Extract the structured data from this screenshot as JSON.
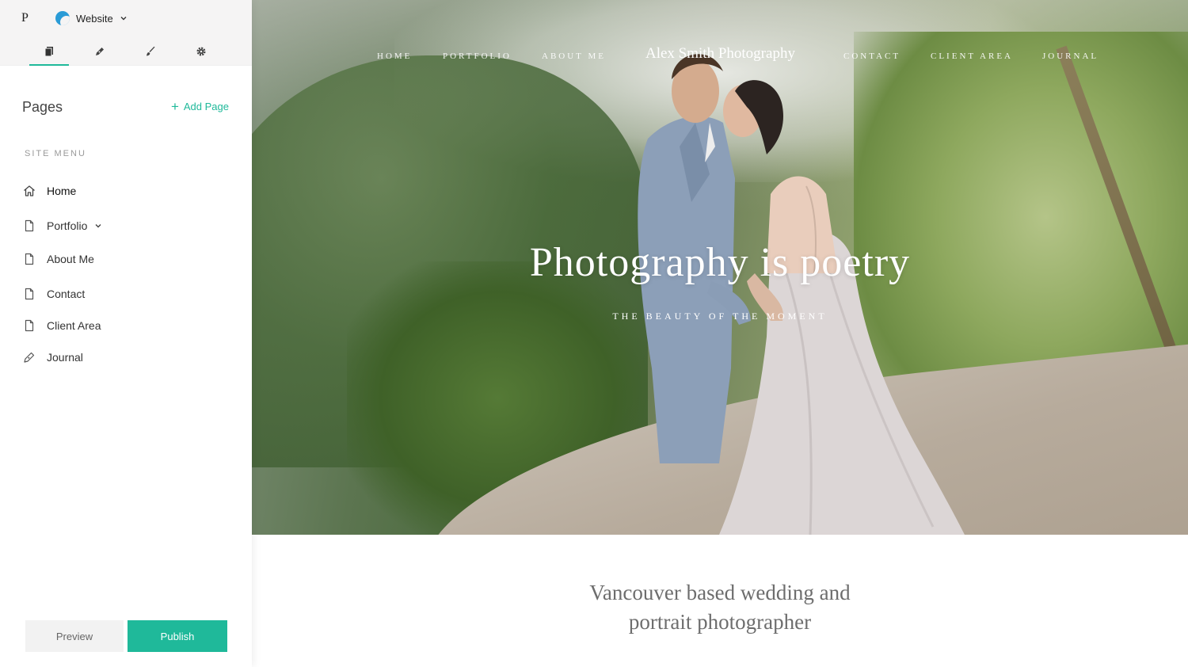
{
  "editor": {
    "brand_letter": "P",
    "site_selector": {
      "label": "Website"
    },
    "tabs": [
      {
        "name": "pages-icon",
        "active": true
      },
      {
        "name": "pen-icon",
        "active": false
      },
      {
        "name": "brush-icon",
        "active": false
      },
      {
        "name": "gear-icon",
        "active": false
      }
    ],
    "pages_heading": "Pages",
    "add_page_label": "Add Page",
    "site_menu_label": "SITE MENU",
    "menu_items": [
      {
        "label": "Home",
        "icon": "home-icon"
      },
      {
        "label": "Portfolio",
        "icon": "page-icon",
        "has_children": true
      },
      {
        "label": "About Me",
        "icon": "page-icon"
      },
      {
        "label": "Contact",
        "icon": "page-icon"
      },
      {
        "label": "Client Area",
        "icon": "page-icon"
      },
      {
        "label": "Journal",
        "icon": "pen-icon"
      }
    ],
    "preview_label": "Preview",
    "publish_label": "Publish",
    "accent_color": "#1fb99a"
  },
  "site": {
    "nav_left": [
      "HOME",
      "PORTFOLIO",
      "ABOUT ME"
    ],
    "title": "Alex Smith Photography",
    "nav_right": [
      "CONTACT",
      "CLIENT AREA",
      "JOURNAL"
    ],
    "hero_headline": "Photography is poetry",
    "hero_subheadline": "THE BEAUTY OF THE MOMENT",
    "tagline_line1": "Vancouver based wedding and",
    "tagline_line2": "portrait photographer"
  }
}
